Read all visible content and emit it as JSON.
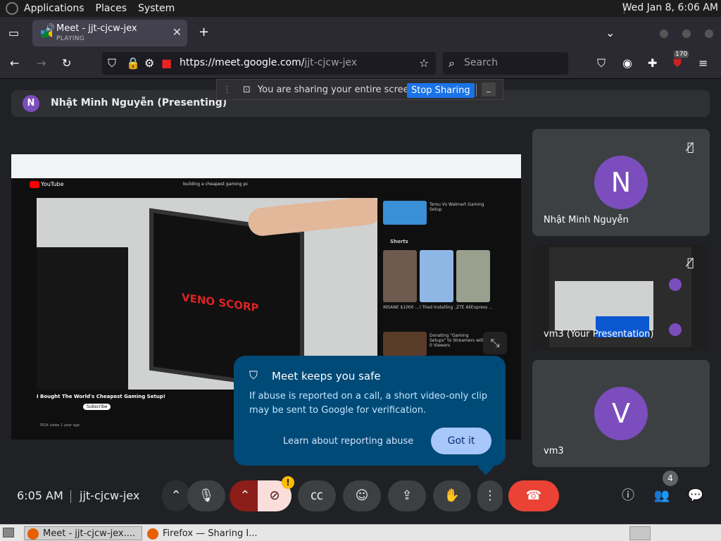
{
  "system_bar": {
    "menus": [
      "Applications",
      "Places",
      "System"
    ],
    "clock": "Wed Jan  8,  6:06 AM"
  },
  "browser": {
    "tab": {
      "title": "Meet - jjt-cjcw-jex",
      "status": "PLAYING"
    },
    "url": {
      "host": "https://meet.google.com/",
      "path": "jjt-cjcw-jex"
    },
    "search_placeholder": "Search",
    "extension_badge": "170"
  },
  "share_notice": {
    "text": "You are sharing your entire screen.",
    "stop_label": "Stop Sharing"
  },
  "presenter": {
    "initial": "N",
    "label": "Nhật Minh Nguyễn (Presenting)"
  },
  "shared_screen": {
    "video_title": "I Bought The World's Cheapest Gaming Setup!",
    "search_query": "building a cheapest gaming pc",
    "brand_on_monitor": "VENO SCORP",
    "shorts_label": "Shorts",
    "subscribe_label": "Subscribe",
    "views_line": "781K views  1 year ago",
    "youtube_label": "YouTube",
    "side_videos": [
      "Temu Vs Walmart Gaming Setup",
      "INSANE $1000 ...",
      "I Tried Installing ...",
      "ZTE AliExpress ...",
      "Donating \"Gaming Setups\" to Streamers with 0 Viewers"
    ]
  },
  "tiles": [
    {
      "initial": "N",
      "name": "Nhật Minh Nguyễn"
    },
    {
      "name": "vm3 (Your Presentation)"
    },
    {
      "initial": "V",
      "name": "vm3"
    }
  ],
  "safety_popup": {
    "title": "Meet keeps you safe",
    "body": "If abuse is reported on a call, a short video-only clip may be sent to Google for verification.",
    "learn_label": "Learn about reporting abuse",
    "got_it_label": "Got it"
  },
  "bottom_bar": {
    "time": "6:05 AM",
    "meeting_code": "jjt-cjcw-jex",
    "participant_count": "4",
    "warning": "!"
  },
  "taskbar": {
    "items": [
      "Meet - jjt-cjcw-jex....",
      "Firefox — Sharing I..."
    ]
  },
  "colors": {
    "accent": "#1a73e8",
    "end_call": "#ea4335",
    "avatar": "#7c4dbd",
    "popup_bg": "#004a77"
  }
}
